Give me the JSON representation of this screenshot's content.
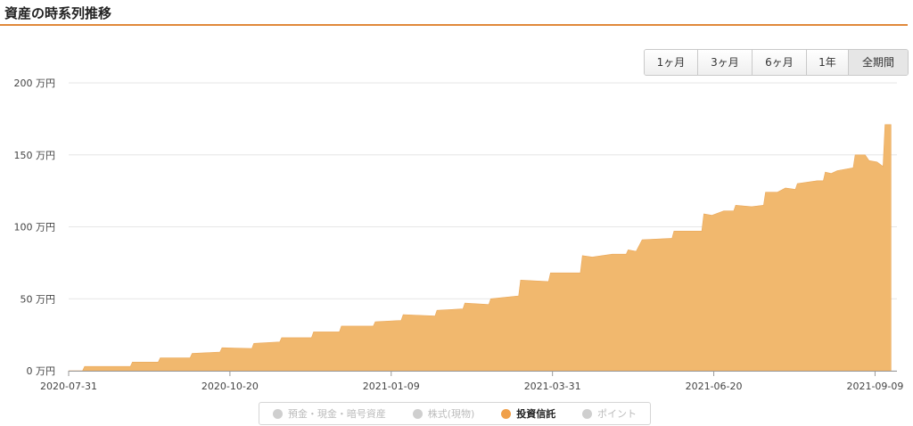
{
  "page_title": "資産の時系列推移",
  "range_buttons": [
    {
      "label": "1ヶ月",
      "active": false
    },
    {
      "label": "3ヶ月",
      "active": false
    },
    {
      "label": "6ヶ月",
      "active": false
    },
    {
      "label": "1年",
      "active": false
    },
    {
      "label": "全期間",
      "active": true
    }
  ],
  "legend": [
    {
      "label": "預金・現金・暗号資産",
      "active": false
    },
    {
      "label": "株式(現物)",
      "active": false
    },
    {
      "label": "投資信託",
      "active": true
    },
    {
      "label": "ポイント",
      "active": false
    }
  ],
  "colors": {
    "accent": "#e0893a",
    "area": "#f1b86e",
    "grid": "#e6e6e6",
    "inactive": "#cfcfcf"
  },
  "chart_data": {
    "type": "area",
    "title": "",
    "xlabel": "",
    "ylabel": "",
    "y_unit": "万円",
    "ylim": [
      0,
      200
    ],
    "yticks": [
      0,
      50,
      100,
      150,
      200
    ],
    "ytick_labels": [
      "0 万円",
      "50 万円",
      "100 万円",
      "150 万円",
      "200 万円"
    ],
    "xticks": [
      "2020-07-31",
      "2020-10-20",
      "2021-01-09",
      "2021-03-31",
      "2021-06-20",
      "2021-09-09"
    ],
    "xlim": [
      "2020-07-31",
      "2021-09-20"
    ],
    "grid": true,
    "series": [
      {
        "name": "投資信託",
        "points": [
          [
            "2020-07-31",
            0
          ],
          [
            "2020-08-07",
            0
          ],
          [
            "2020-08-08",
            3
          ],
          [
            "2020-08-31",
            3
          ],
          [
            "2020-09-01",
            6
          ],
          [
            "2020-09-14",
            6
          ],
          [
            "2020-09-15",
            9
          ],
          [
            "2020-09-30",
            9
          ],
          [
            "2020-10-01",
            12
          ],
          [
            "2020-10-15",
            13
          ],
          [
            "2020-10-16",
            16
          ],
          [
            "2020-10-31",
            15.5
          ],
          [
            "2020-11-01",
            19
          ],
          [
            "2020-11-14",
            20
          ],
          [
            "2020-11-15",
            23
          ],
          [
            "2020-11-30",
            23
          ],
          [
            "2020-12-01",
            27
          ],
          [
            "2020-12-14",
            27
          ],
          [
            "2020-12-15",
            31
          ],
          [
            "2020-12-31",
            31
          ],
          [
            "2021-01-01",
            34
          ],
          [
            "2021-01-14",
            35
          ],
          [
            "2021-01-15",
            39
          ],
          [
            "2021-01-31",
            38
          ],
          [
            "2021-02-01",
            42
          ],
          [
            "2021-02-14",
            43
          ],
          [
            "2021-02-15",
            47
          ],
          [
            "2021-02-27",
            46
          ],
          [
            "2021-02-28",
            50
          ],
          [
            "2021-03-14",
            52
          ],
          [
            "2021-03-15",
            63
          ],
          [
            "2021-03-29",
            62
          ],
          [
            "2021-03-30",
            68
          ],
          [
            "2021-04-14",
            68
          ],
          [
            "2021-04-15",
            80
          ],
          [
            "2021-04-20",
            79
          ],
          [
            "2021-04-30",
            81
          ],
          [
            "2021-05-07",
            81
          ],
          [
            "2021-05-08",
            84
          ],
          [
            "2021-05-12",
            83
          ],
          [
            "2021-05-15",
            91
          ],
          [
            "2021-05-30",
            92
          ],
          [
            "2021-05-31",
            97
          ],
          [
            "2021-06-14",
            97
          ],
          [
            "2021-06-15",
            109
          ],
          [
            "2021-06-19",
            108
          ],
          [
            "2021-06-25",
            111
          ],
          [
            "2021-06-30",
            111
          ],
          [
            "2021-07-01",
            115
          ],
          [
            "2021-07-09",
            114
          ],
          [
            "2021-07-15",
            115
          ],
          [
            "2021-07-16",
            124
          ],
          [
            "2021-07-22",
            124
          ],
          [
            "2021-07-26",
            127
          ],
          [
            "2021-07-31",
            126
          ],
          [
            "2021-08-01",
            130
          ],
          [
            "2021-08-11",
            132
          ],
          [
            "2021-08-14",
            132
          ],
          [
            "2021-08-15",
            138
          ],
          [
            "2021-08-18",
            137
          ],
          [
            "2021-08-21",
            139
          ],
          [
            "2021-08-29",
            141
          ],
          [
            "2021-08-30",
            150
          ],
          [
            "2021-09-04",
            150
          ],
          [
            "2021-09-06",
            146
          ],
          [
            "2021-09-10",
            145
          ],
          [
            "2021-09-13",
            142
          ],
          [
            "2021-09-14",
            171
          ],
          [
            "2021-09-17",
            171
          ]
        ]
      }
    ]
  }
}
